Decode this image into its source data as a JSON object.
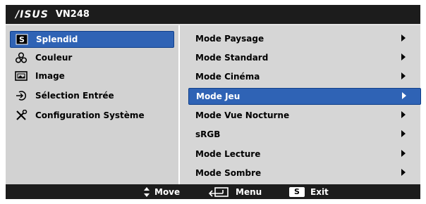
{
  "header": {
    "brand": "/ISUS",
    "model": "VN248"
  },
  "menu": [
    {
      "label": "Splendid",
      "icon": "splendid-s-icon",
      "selected": true
    },
    {
      "label": "Couleur",
      "icon": "color-dots-icon",
      "selected": false
    },
    {
      "label": "Image",
      "icon": "image-icon",
      "selected": false
    },
    {
      "label": "Sélection Entrée",
      "icon": "input-select-icon",
      "selected": false
    },
    {
      "label": "Configuration Système",
      "icon": "tools-icon",
      "selected": false
    }
  ],
  "submenu": [
    {
      "label": "Mode Paysage",
      "selected": false
    },
    {
      "label": "Mode Standard",
      "selected": false
    },
    {
      "label": "Mode Cinéma",
      "selected": false
    },
    {
      "label": "Mode Jeu",
      "selected": true
    },
    {
      "label": "Mode Vue Nocturne",
      "selected": false
    },
    {
      "label": "sRGB",
      "selected": false
    },
    {
      "label": "Mode Lecture",
      "selected": false
    },
    {
      "label": "Mode Sombre",
      "selected": false
    }
  ],
  "footer": {
    "move_label": "Move",
    "menu_label": "Menu",
    "exit_key": "S",
    "exit_label": "Exit"
  },
  "colors": {
    "highlight": "#2f63b5",
    "bar": "#1c1c1c",
    "panel_left": "#d2d2d2",
    "panel_right": "#d6d6d6"
  }
}
